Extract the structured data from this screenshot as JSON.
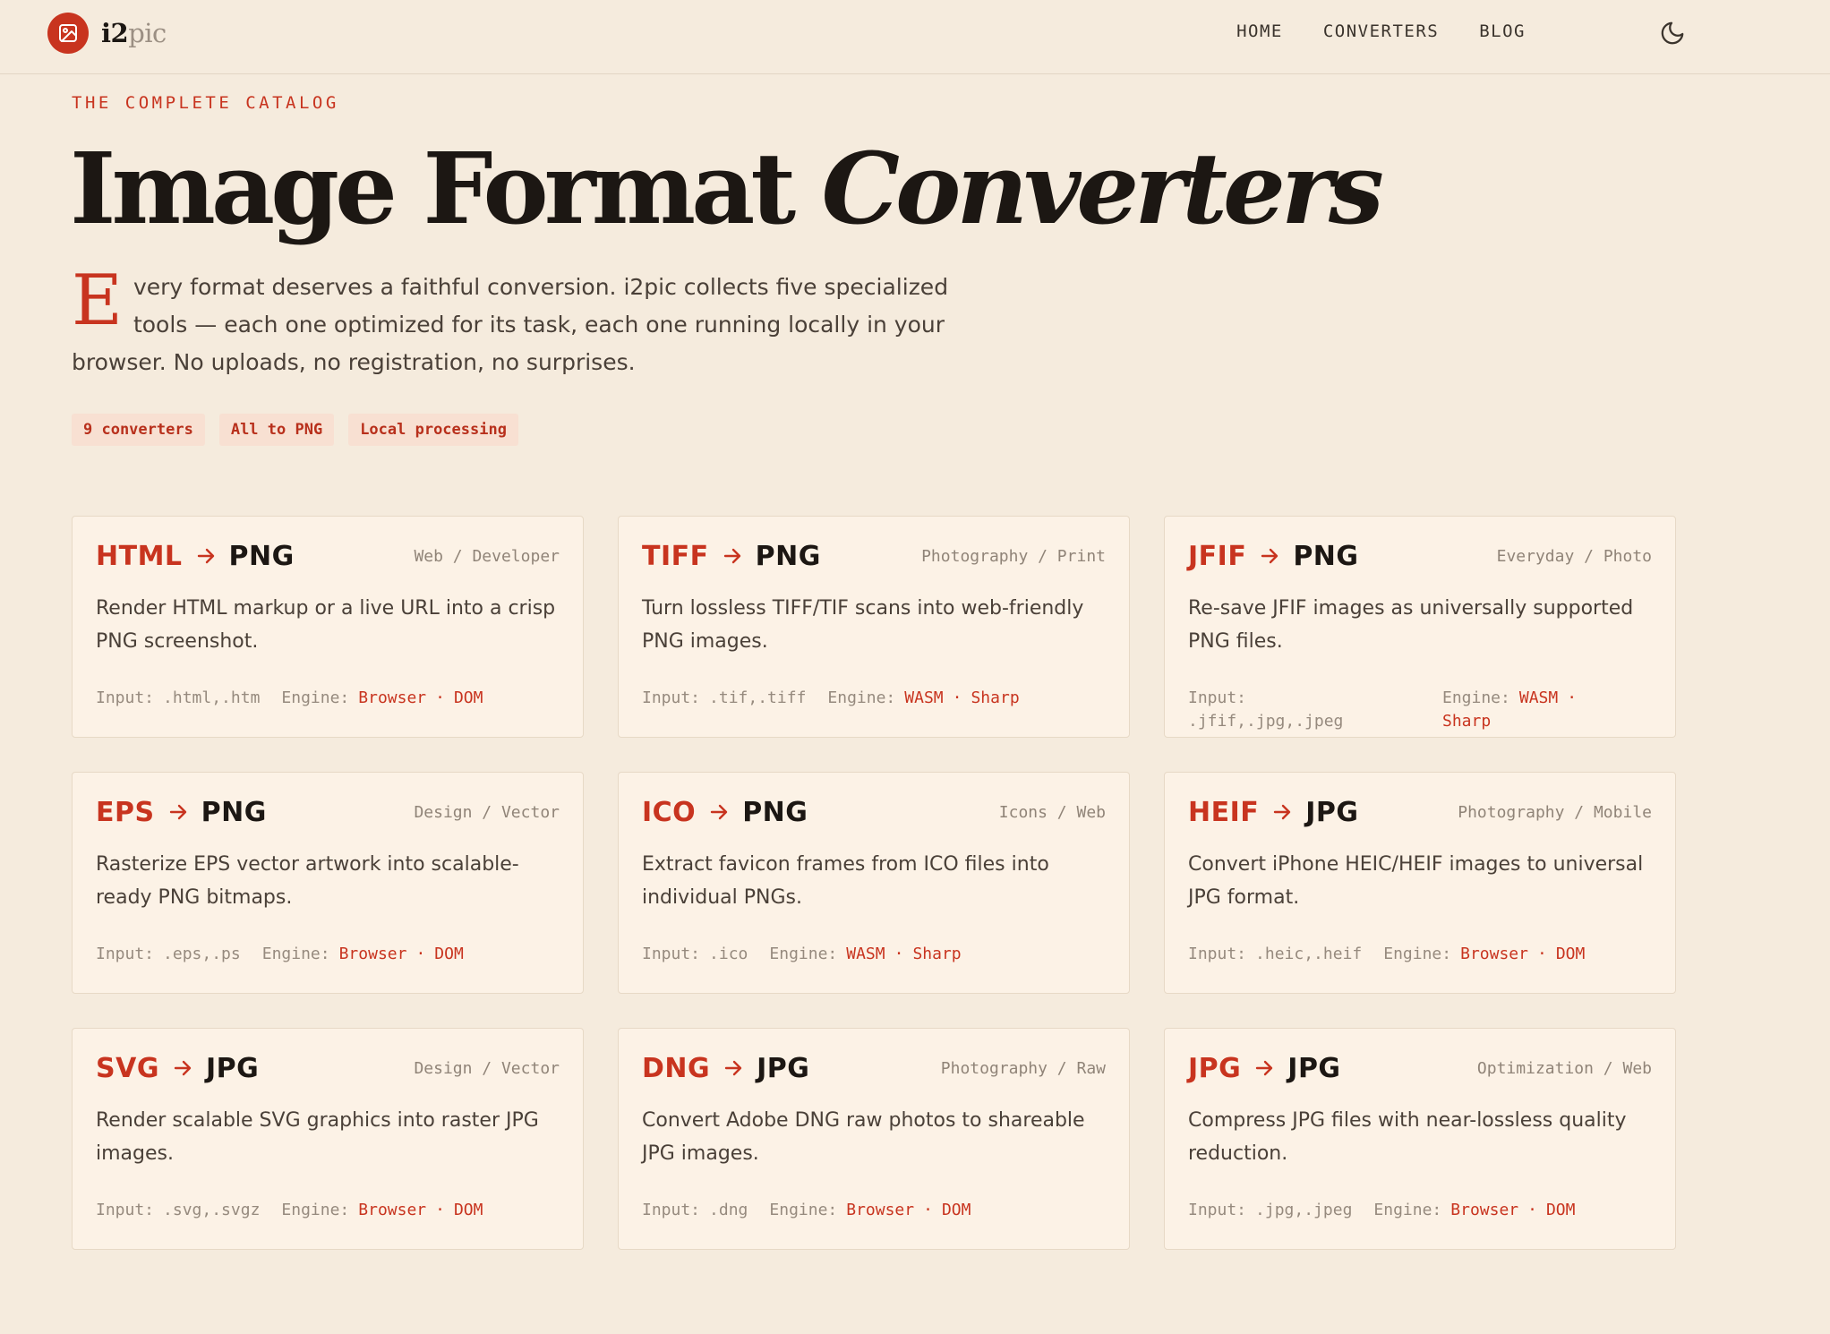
{
  "brand": {
    "name_main": "i2",
    "name_dim": "pic"
  },
  "nav": {
    "links": [
      "HOME",
      "CONVERTERS",
      "BLOG"
    ]
  },
  "hero": {
    "eyebrow": "THE COMPLETE CATALOG",
    "title_main": "Image Format ",
    "title_italic": "Converters",
    "dropcap": "E",
    "intro": "very format deserves a faithful conversion. i2pic collects five specialized tools — each one optimized for its task, each one running locally in your browser. No uploads, no registration, no surprises.",
    "tags": [
      "9 converters",
      "All to PNG",
      "Local processing"
    ]
  },
  "cards": [
    {
      "from": "HTML",
      "to": "PNG",
      "category": "Web / Developer",
      "desc": "Render HTML markup or a live URL into a crisp PNG screenshot.",
      "input_label": "Input:",
      "input": ".html,.htm",
      "engine_label": "Engine:",
      "engine_a": "Browser",
      "sep": "·",
      "engine_b": "DOM"
    },
    {
      "from": "TIFF",
      "to": "PNG",
      "category": "Photography / Print",
      "desc": "Turn lossless TIFF/TIF scans into web-friendly PNG images.",
      "input_label": "Input:",
      "input": ".tif,.tiff",
      "engine_label": "Engine:",
      "engine_a": "WASM",
      "sep": "·",
      "engine_b": "Sharp"
    },
    {
      "from": "JFIF",
      "to": "PNG",
      "category": "Everyday / Photo",
      "desc": "Re-save JFIF images as universally supported PNG files.",
      "input_label": "Input:",
      "input": ".jfif,.jpg,.jpeg",
      "engine_label": "Engine:",
      "engine_a": "WASM",
      "sep": "·",
      "engine_b": "Sharp"
    },
    {
      "from": "EPS",
      "to": "PNG",
      "category": "Design / Vector",
      "desc": "Rasterize EPS vector artwork into scalable-ready PNG bitmaps.",
      "input_label": "Input:",
      "input": ".eps,.ps",
      "engine_label": "Engine:",
      "engine_a": "Browser",
      "sep": "·",
      "engine_b": "DOM"
    },
    {
      "from": "ICO",
      "to": "PNG",
      "category": "Icons / Web",
      "desc": "Extract favicon frames from ICO files into individual PNGs.",
      "input_label": "Input:",
      "input": ".ico",
      "engine_label": "Engine:",
      "engine_a": "WASM",
      "sep": "·",
      "engine_b": "Sharp"
    },
    {
      "from": "HEIF",
      "to": "JPG",
      "category": "Photography / Mobile",
      "desc": "Convert iPhone HEIC/HEIF images to universal JPG format.",
      "input_label": "Input:",
      "input": ".heic,.heif",
      "engine_label": "Engine:",
      "engine_a": "Browser",
      "sep": "·",
      "engine_b": "DOM"
    },
    {
      "from": "SVG",
      "to": "JPG",
      "category": "Design / Vector",
      "desc": "Render scalable SVG graphics into raster JPG images.",
      "input_label": "Input:",
      "input": ".svg,.svgz",
      "engine_label": "Engine:",
      "engine_a": "Browser",
      "sep": "·",
      "engine_b": "DOM"
    },
    {
      "from": "DNG",
      "to": "JPG",
      "category": "Photography / Raw",
      "desc": "Convert Adobe DNG raw photos to shareable JPG images.",
      "input_label": "Input:",
      "input": ".dng",
      "engine_label": "Engine:",
      "engine_a": "Browser",
      "sep": "·",
      "engine_b": "DOM"
    },
    {
      "from": "JPG",
      "to": "JPG",
      "category": "Optimization / Web",
      "desc": "Compress JPG files with near-lossless quality reduction.",
      "input_label": "Input:",
      "input": ".jpg,.jpeg",
      "engine_label": "Engine:",
      "engine_a": "Browser",
      "sep": "·",
      "engine_b": "DOM"
    }
  ],
  "icons": {
    "logo": "image-icon",
    "theme": "moon-icon",
    "arrow": "arrow-right-icon"
  },
  "colors": {
    "accent": "#c8341f",
    "background": "#f5ebdd",
    "card": "#fcf2e6",
    "tag_bg": "#f8e0d2"
  }
}
